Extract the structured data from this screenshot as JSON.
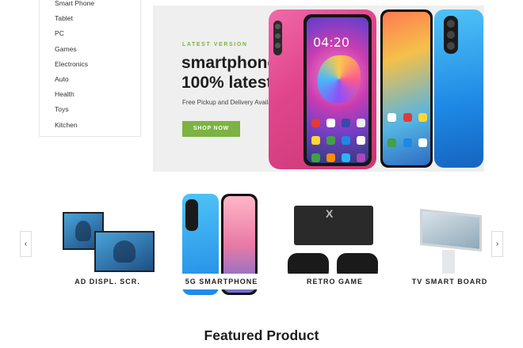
{
  "sidebar": {
    "items": [
      "Smart Phone",
      "Tablet",
      "PC",
      "Games",
      "Electronics",
      "Auto",
      "Health",
      "Toys",
      "Kitchen"
    ]
  },
  "hero": {
    "tag": "LATEST VERSION",
    "title": "smartphone 100% latest",
    "subtitle": "Free Pickup and Delivery Available",
    "button": "SHOP NOW",
    "phone_clock": "04:20",
    "accent_color": "#7cb342"
  },
  "categories": {
    "prev_icon": "‹",
    "next_icon": "›",
    "items": [
      {
        "label": "AD DISPL. SCR."
      },
      {
        "label": "5G SMARTPHONE"
      },
      {
        "label": "RETRO GAME"
      },
      {
        "label": "TV SMART BOARD"
      }
    ]
  },
  "featured": {
    "title": "Featured Product"
  }
}
